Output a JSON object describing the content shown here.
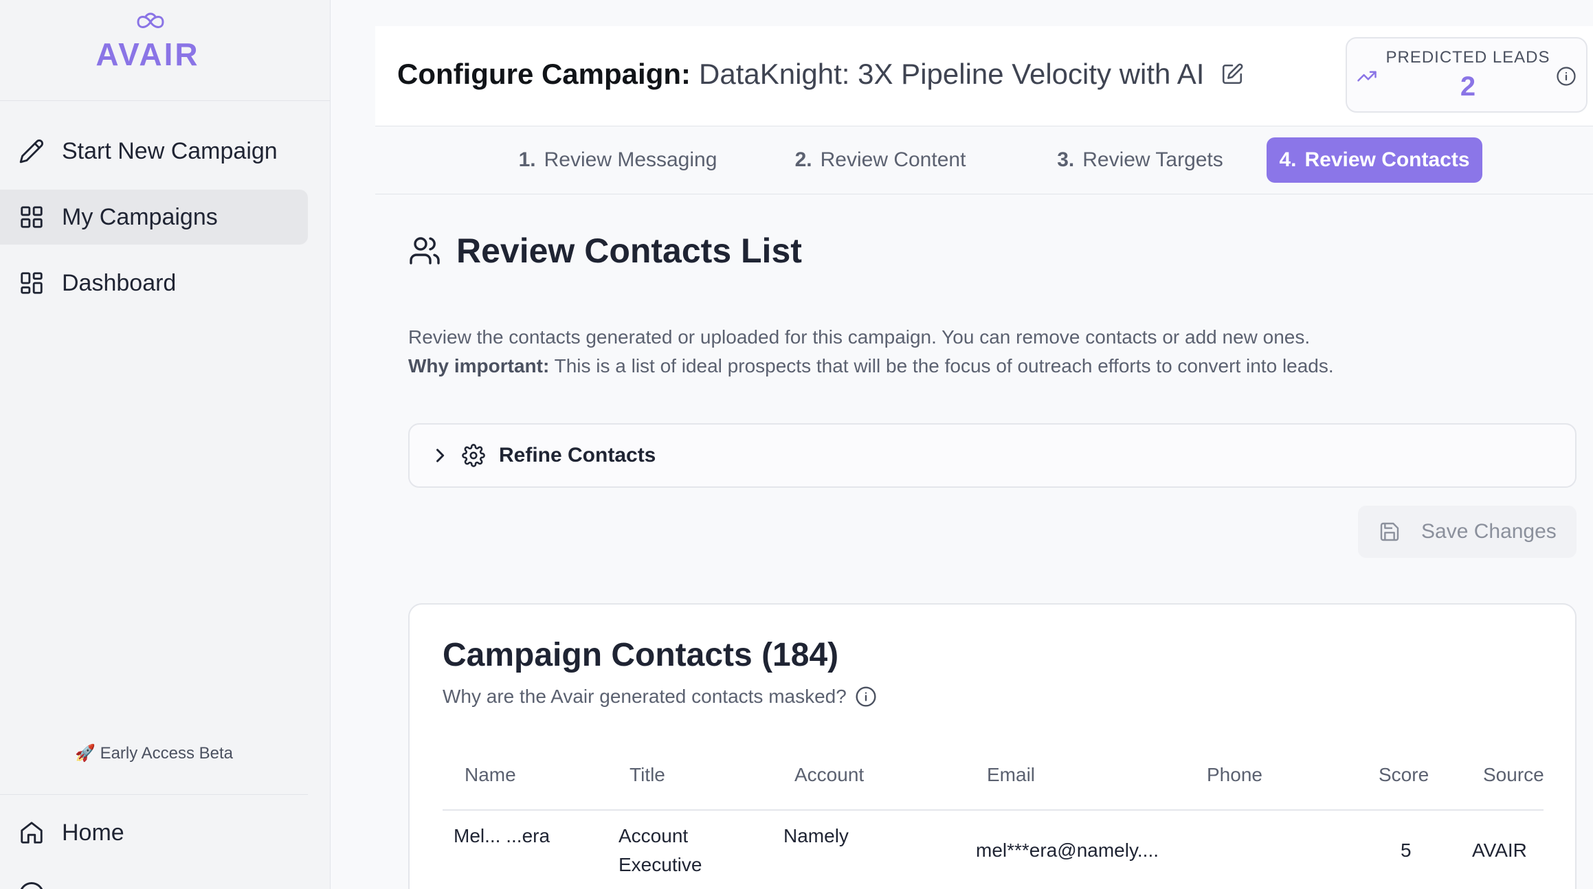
{
  "brand": {
    "logo_text": "AVAIR",
    "accent_color": "#8b76e8"
  },
  "sidebar": {
    "items": [
      {
        "label": "Start New Campaign",
        "icon": "pencil-icon"
      },
      {
        "label": "My Campaigns",
        "icon": "grid-icon",
        "active": true
      },
      {
        "label": "Dashboard",
        "icon": "dashboard-icon"
      }
    ],
    "beta_label": "🚀 Early Access Beta",
    "home_label": "Home"
  },
  "header": {
    "title_prefix": "Configure Campaign:",
    "campaign_name": "DataKnight: 3X Pipeline Velocity with AI",
    "predicted_leads_label": "PREDICTED LEADS",
    "predicted_leads_value": "2"
  },
  "steps": [
    {
      "num": "1.",
      "label": "Review Messaging"
    },
    {
      "num": "2.",
      "label": "Review Content"
    },
    {
      "num": "3.",
      "label": "Review Targets"
    },
    {
      "num": "4.",
      "label": "Review Contacts",
      "active": true
    }
  ],
  "section": {
    "title": "Review Contacts List",
    "description": "Review the contacts generated or uploaded for this campaign. You can remove contacts or add new ones.",
    "why_label": "Why important:",
    "why_text": " This is a list of ideal prospects that will be the focus of outreach efforts to convert into leads.",
    "refine_label": "Refine Contacts",
    "save_label": "Save Changes"
  },
  "contacts": {
    "title": "Campaign Contacts (184)",
    "masked_question": "Why are the Avair generated contacts masked?",
    "columns": [
      "Name",
      "Title",
      "Account",
      "Email",
      "Phone",
      "Score",
      "Source"
    ],
    "rows": [
      {
        "name": "Mel... ...era",
        "title_line1": "Account",
        "title_line2": "Executive",
        "account": "Namely",
        "email": "mel***era@namely....",
        "phone": "",
        "score": "5",
        "source": "AVAIR"
      }
    ]
  }
}
